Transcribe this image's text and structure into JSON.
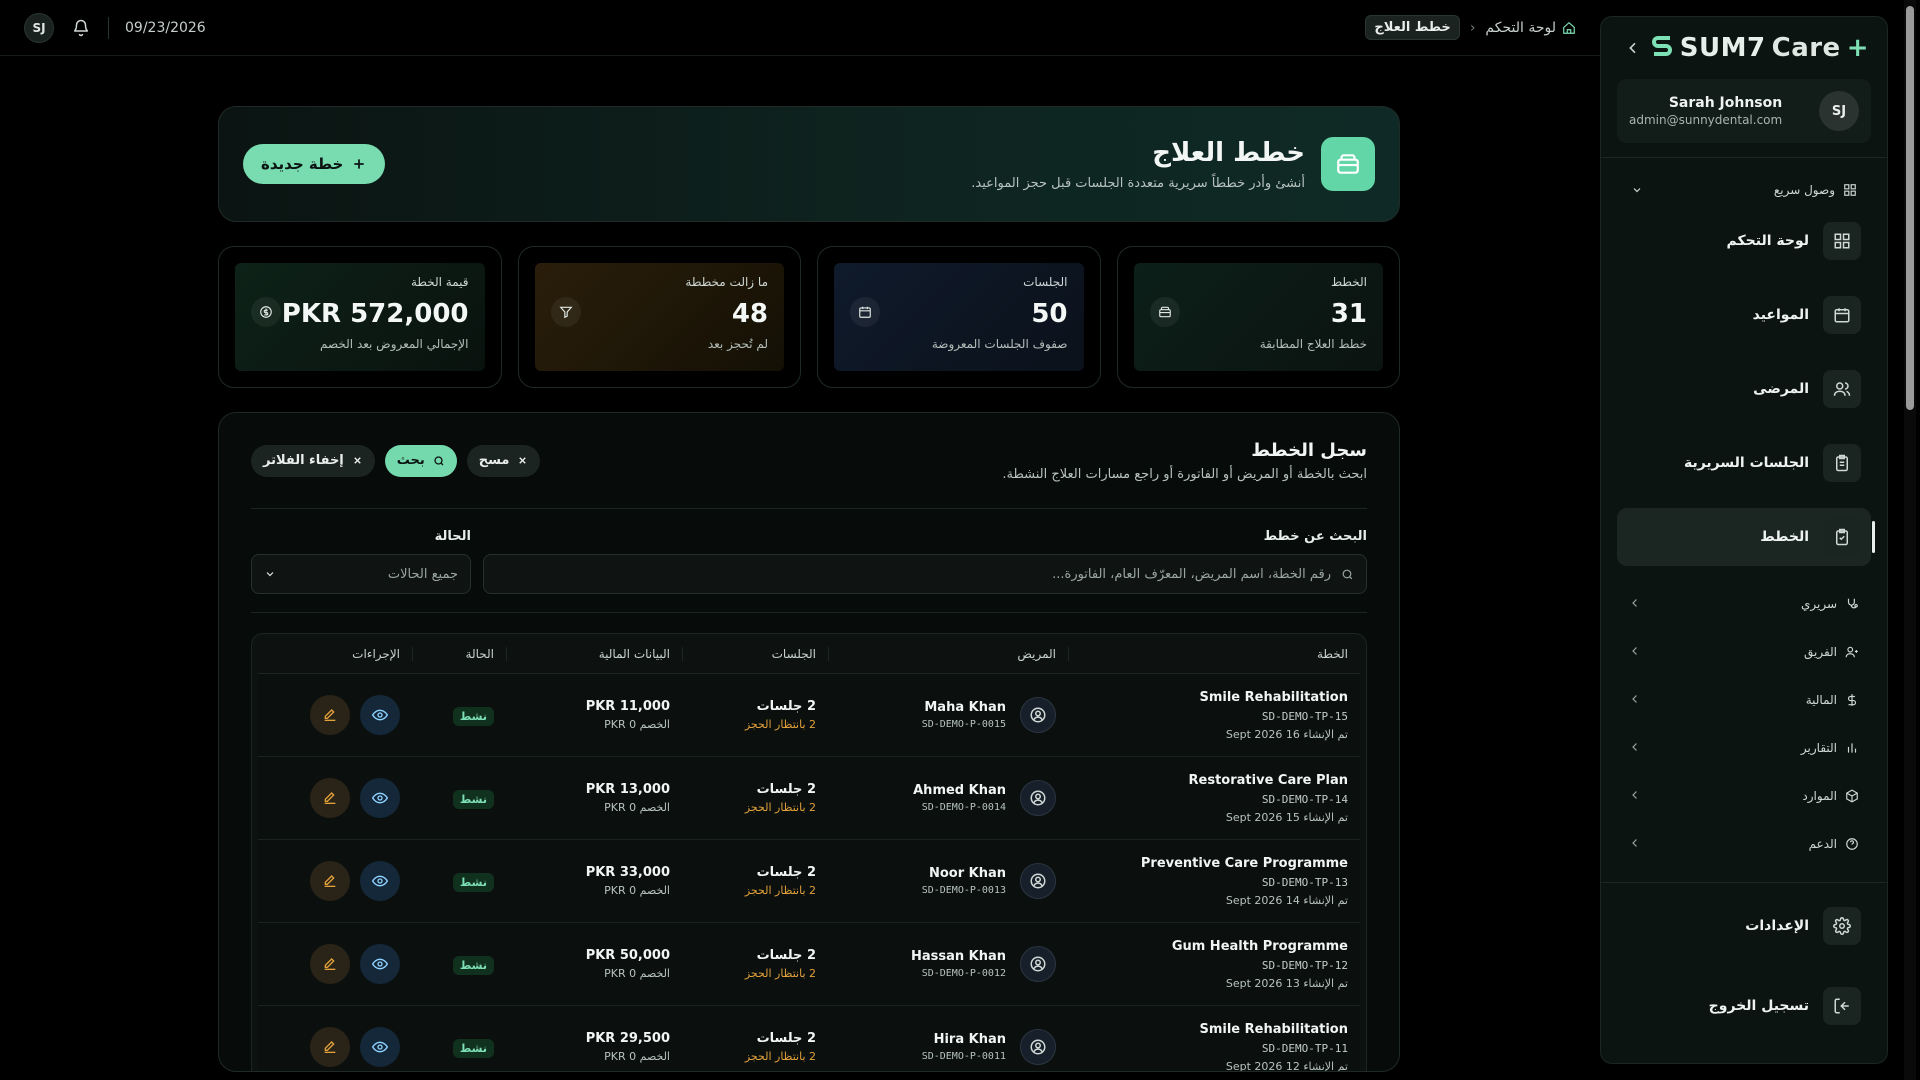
{
  "topbar": {
    "user_initials": "SJ",
    "date": "09/23/2026",
    "breadcrumb": {
      "home": "لوحة التحكم",
      "current": "خطط العلاج"
    }
  },
  "sidebar": {
    "brand": {
      "name": "SUM7",
      "suffix": "Care"
    },
    "user": {
      "initials": "SJ",
      "name": "Sarah Johnson",
      "email": "admin@sunnydental.com"
    },
    "quick_access": "وصول سريع",
    "main_items": [
      {
        "label": "لوحة التحكم",
        "icon": "dashboard-icon"
      },
      {
        "label": "المواعيد",
        "icon": "calendar-icon"
      },
      {
        "label": "المرضى",
        "icon": "users-icon"
      },
      {
        "label": "الجلسات السريرية",
        "icon": "clipboard-icon"
      },
      {
        "label": "الخطط",
        "icon": "plan-icon",
        "active": true
      }
    ],
    "groups": [
      {
        "label": "سريري",
        "icon": "stethoscope-icon"
      },
      {
        "label": "الفريق",
        "icon": "team-icon"
      },
      {
        "label": "المالية",
        "icon": "dollar-icon"
      },
      {
        "label": "التقارير",
        "icon": "chart-icon"
      },
      {
        "label": "الموارد",
        "icon": "box-icon"
      },
      {
        "label": "الدعم",
        "icon": "help-icon"
      }
    ],
    "bottom_items": [
      {
        "label": "الإعدادات",
        "icon": "gear-icon"
      },
      {
        "label": "تسجيل الخروج",
        "icon": "logout-icon"
      }
    ]
  },
  "hero": {
    "title": "خطط العلاج",
    "subtitle": "أنشئ وأدر خططاً سريرية متعددة الجلسات قبل حجز المواعيد.",
    "new_button": "خطة جديدة"
  },
  "stats": [
    {
      "label": "الخطط",
      "value": "31",
      "sub": "خطط العلاج المطابقة",
      "theme": "green",
      "icon": "plan-icon"
    },
    {
      "label": "الجلسات",
      "value": "50",
      "sub": "صفوف الجلسات المعروضة",
      "theme": "blue",
      "icon": "calendar-icon"
    },
    {
      "label": "ما زالت مخططة",
      "value": "48",
      "sub": "لم تُحجز بعد",
      "theme": "amber",
      "icon": "filter-icon"
    },
    {
      "label": "قيمة الخطة",
      "value": "PKR 572,000",
      "sub": "الإجمالي المعروض بعد الخصم",
      "theme": "green2",
      "icon": "dollar-circle-icon"
    }
  ],
  "log": {
    "title": "سجل الخطط",
    "subtitle": "ابحث بالخطة أو المريض أو الفاتورة أو راجع مسارات العلاج النشطة.",
    "chips": {
      "clear": "مسح",
      "search": "بحث",
      "hide": "إخفاء الفلاتر"
    },
    "search_label": "البحث عن خطط",
    "search_placeholder": "رقم الخطة، اسم المريض، المعرّف العام، الفاتورة...",
    "status_label": "الحالة",
    "status_value": "جميع الحالات"
  },
  "table": {
    "headers": [
      "الخطة",
      "المريض",
      "الجلسات",
      "البيانات المالية",
      "الحالة",
      "الإجراءات"
    ],
    "rows": [
      {
        "plan": "Smile Rehabilitation",
        "plan_id": "SD-DEMO-TP-15",
        "created": "تم الإنشاء 16 Sept 2026",
        "patient": "Maha Khan",
        "patient_id": "SD-DEMO-P-0015",
        "sessions": "2 جلسات",
        "pending": "2 بانتظار الحجز",
        "amount": "PKR 11,000",
        "discount": "الخصم 0 PKR",
        "status": "نشط"
      },
      {
        "plan": "Restorative Care Plan",
        "plan_id": "SD-DEMO-TP-14",
        "created": "تم الإنشاء 15 Sept 2026",
        "patient": "Ahmed Khan",
        "patient_id": "SD-DEMO-P-0014",
        "sessions": "2 جلسات",
        "pending": "2 بانتظار الحجز",
        "amount": "PKR 13,000",
        "discount": "الخصم 0 PKR",
        "status": "نشط"
      },
      {
        "plan": "Preventive Care Programme",
        "plan_id": "SD-DEMO-TP-13",
        "created": "تم الإنشاء 14 Sept 2026",
        "patient": "Noor Khan",
        "patient_id": "SD-DEMO-P-0013",
        "sessions": "2 جلسات",
        "pending": "2 بانتظار الحجز",
        "amount": "PKR 33,000",
        "discount": "الخصم 0 PKR",
        "status": "نشط"
      },
      {
        "plan": "Gum Health Programme",
        "plan_id": "SD-DEMO-TP-12",
        "created": "تم الإنشاء 13 Sept 2026",
        "patient": "Hassan Khan",
        "patient_id": "SD-DEMO-P-0012",
        "sessions": "2 جلسات",
        "pending": "2 بانتظار الحجز",
        "amount": "PKR 50,000",
        "discount": "الخصم 0 PKR",
        "status": "نشط"
      },
      {
        "plan": "Smile Rehabilitation",
        "plan_id": "SD-DEMO-TP-11",
        "created": "تم الإنشاء 12 Sept 2026",
        "patient": "Hira Khan",
        "patient_id": "SD-DEMO-P-0011",
        "sessions": "2 جلسات",
        "pending": "2 بانتظار الحجز",
        "amount": "PKR 29,500",
        "discount": "الخصم 0 PKR",
        "status": "نشط"
      }
    ]
  },
  "colors": {
    "accent": "#78dcb0",
    "pending": "#e2a13a",
    "background": "#000000"
  }
}
